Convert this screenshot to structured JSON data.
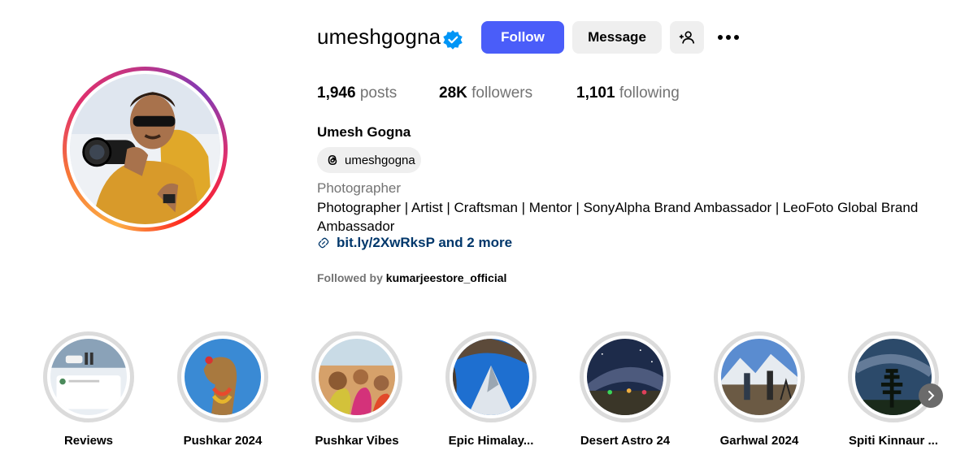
{
  "profile": {
    "username": "umeshgogna",
    "full_name": "Umesh Gogna",
    "threads_handle": "umeshgogna",
    "category": "Photographer",
    "bio": "Photographer | Artist | Craftsman | Mentor | SonyAlpha Brand Ambassador | LeoFoto Global Brand Ambassador",
    "link": "bit.ly/2XwRksP and 2 more",
    "followed_by_prefix": "Followed by",
    "followed_by_user": "kumarjeestore_official"
  },
  "actions": {
    "follow_label": "Follow",
    "message_label": "Message"
  },
  "stats": {
    "posts_count": "1,946",
    "posts_label": "posts",
    "followers_count": "28K",
    "followers_label": "followers",
    "following_count": "1,101",
    "following_label": "following"
  },
  "highlights": [
    {
      "label": "Reviews"
    },
    {
      "label": "Pushkar 2024"
    },
    {
      "label": "Pushkar Vibes"
    },
    {
      "label": "Epic Himalay..."
    },
    {
      "label": "Desert Astro 24"
    },
    {
      "label": "Garhwal 2024"
    },
    {
      "label": "Spiti Kinnaur ..."
    }
  ],
  "review_card_text": "Umesh Gogna's masterclass is one of its kind for Budding, Amateur, Non -professional and professional.",
  "colors": {
    "follow_button": "#4a5df9",
    "secondary_button": "#efefef",
    "link": "#00376b",
    "muted_text": "#737373",
    "verified_badge": "#0095f6"
  },
  "icons": [
    "verified-badge-icon",
    "add-user-icon",
    "more-options-icon",
    "threads-icon",
    "link-icon",
    "chevron-right-icon"
  ]
}
